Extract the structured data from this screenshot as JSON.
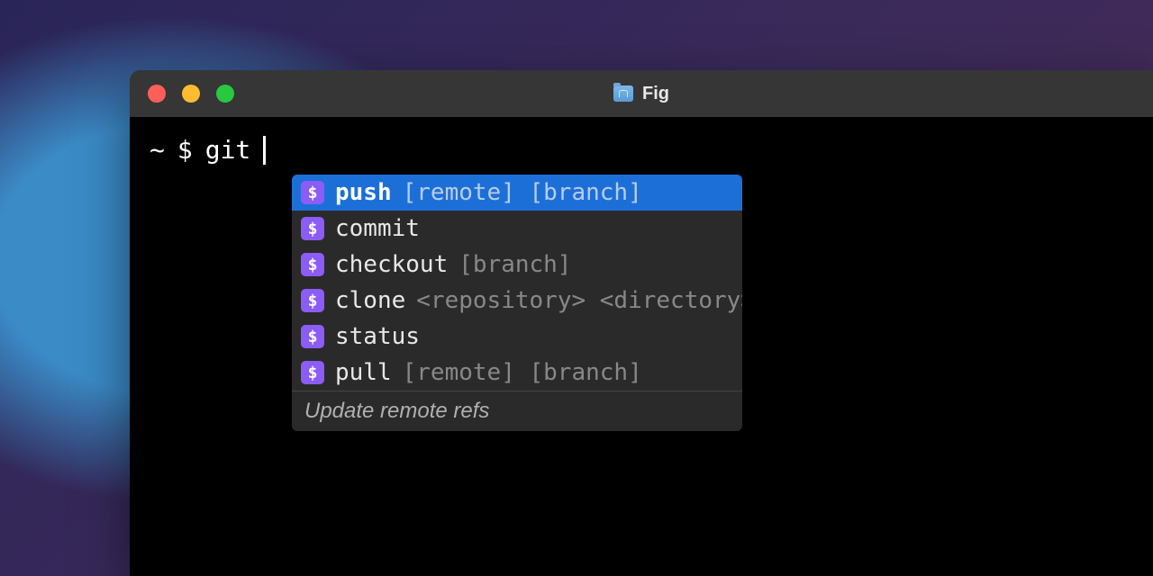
{
  "window": {
    "title": "Fig"
  },
  "prompt": {
    "cwd": "~",
    "symbol": "$",
    "command": "git"
  },
  "autocomplete": {
    "items": [
      {
        "command": "push",
        "args": "[remote] [branch]",
        "selected": true
      },
      {
        "command": "commit",
        "args": "",
        "selected": false
      },
      {
        "command": "checkout",
        "args": "[branch]",
        "selected": false
      },
      {
        "command": "clone",
        "args": "<repository> <directory>",
        "selected": false
      },
      {
        "command": "status",
        "args": "",
        "selected": false
      },
      {
        "command": "pull",
        "args": "[remote] [branch]",
        "selected": false
      }
    ],
    "description": "Update remote refs",
    "icon_char": "$"
  }
}
